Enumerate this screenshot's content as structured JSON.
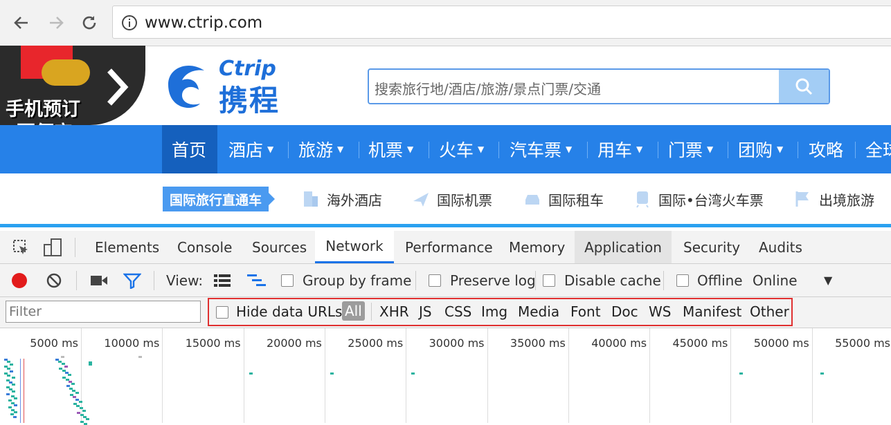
{
  "browser": {
    "url": "www.ctrip.com"
  },
  "promo": {
    "line1": "手机预订",
    "line2": "更便宜"
  },
  "logo": {
    "en": "Ctrip",
    "cn": "携程"
  },
  "site_search": {
    "placeholder": "搜索旅行地/酒店/旅游/景点门票/交通"
  },
  "main_nav": [
    {
      "label": "首页",
      "dropdown": false
    },
    {
      "label": "酒店",
      "dropdown": true
    },
    {
      "label": "旅游",
      "dropdown": true
    },
    {
      "label": "机票",
      "dropdown": true
    },
    {
      "label": "火车",
      "dropdown": true
    },
    {
      "label": "汽车票",
      "dropdown": true
    },
    {
      "label": "用车",
      "dropdown": true
    },
    {
      "label": "门票",
      "dropdown": true
    },
    {
      "label": "团购",
      "dropdown": true
    },
    {
      "label": "攻略",
      "dropdown": false
    },
    {
      "label": "全球",
      "dropdown": false
    }
  ],
  "sub_nav": {
    "badge": "国际旅行直通车",
    "items": [
      "海外酒店",
      "国际机票",
      "国际租车",
      "国际•台湾火车票",
      "出境旅游"
    ]
  },
  "devtools": {
    "tabs": [
      "Elements",
      "Console",
      "Sources",
      "Network",
      "Performance",
      "Memory",
      "Application",
      "Security",
      "Audits"
    ],
    "active_tab": "Network",
    "hover_tab": "Application",
    "toolbar": {
      "view_label": "View:",
      "group_by_frame": "Group by frame",
      "preserve_log": "Preserve log",
      "disable_cache": "Disable cache",
      "offline": "Offline",
      "throttle": "Online"
    },
    "filter": {
      "placeholder": "Filter",
      "hide_data_urls": "Hide data URLs",
      "types": [
        "All",
        "XHR",
        "JS",
        "CSS",
        "Img",
        "Media",
        "Font",
        "Doc",
        "WS",
        "Manifest",
        "Other"
      ]
    },
    "timeline": {
      "ticks": [
        "5000 ms",
        "10000 ms",
        "15000 ms",
        "20000 ms",
        "25000 ms",
        "30000 ms",
        "35000 ms",
        "40000 ms",
        "45000 ms",
        "50000 ms",
        "55000 ms"
      ]
    }
  },
  "colors": {
    "brand_blue": "#2681e8",
    "devtools_accent": "#1a73e8",
    "highlight_red": "#e03030"
  }
}
